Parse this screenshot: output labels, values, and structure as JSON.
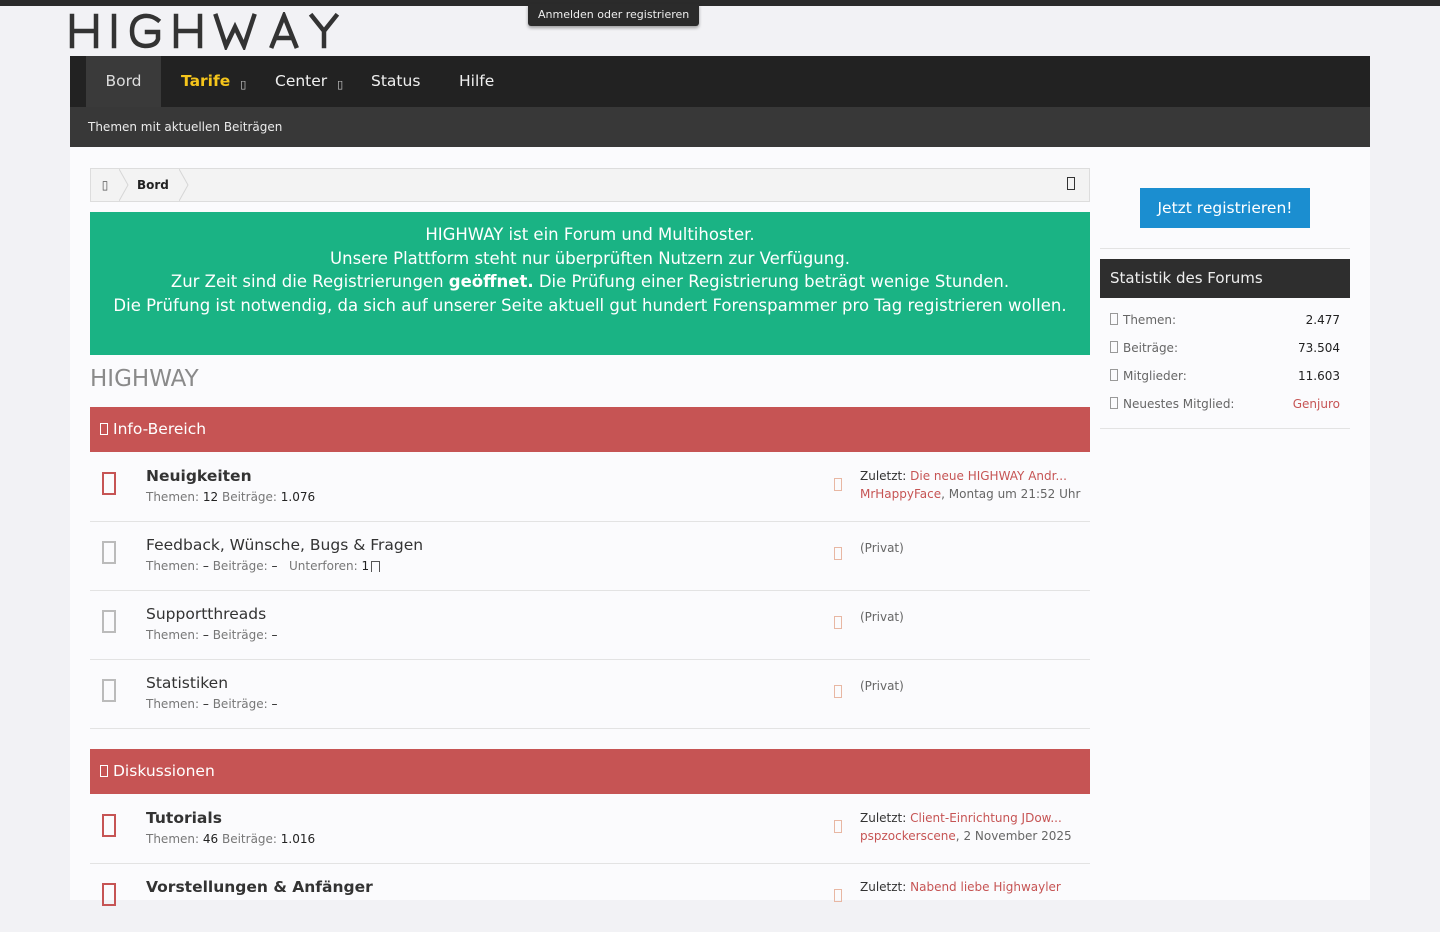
{
  "header": {
    "login_tab": "Anmelden oder registrieren",
    "logo_text": "HIGHWAY"
  },
  "nav": {
    "items": [
      {
        "label": "Bord"
      },
      {
        "label": "Tarife"
      },
      {
        "label": "Center"
      },
      {
        "label": "Status"
      },
      {
        "label": "Hilfe"
      }
    ],
    "sub_link": "Themen mit aktuellen Beiträgen"
  },
  "breadcrumb": {
    "current": "Bord"
  },
  "notice": {
    "line1": "HIGHWAY ist ein Forum und Multihoster.",
    "line2": "Unsere Plattform steht nur überprüften Nutzern zur Verfügung.",
    "line3_before": "Zur Zeit sind die Registrierungen ",
    "line3_bold": "geöffnet.",
    "line3_after": " Die Prüfung einer Registrierung beträgt wenige Stunden.",
    "line4": "Die Prüfung ist notwendig, da sich auf unserer Seite aktuell gut hundert Forenspammer pro Tag registrieren wollen.",
    "color": "#1ab384"
  },
  "forum": {
    "title": "HIGHWAY",
    "labels": {
      "themen": "Themen:",
      "beitraege": "Beiträge:",
      "unterforen": "Unterforen:",
      "zuletzt": "Zuletzt:",
      "privat": "(Privat)"
    },
    "categories": [
      {
        "name": "Info-Bereich",
        "forums": [
          {
            "name": "Neuigkeiten",
            "themen": "12",
            "beitraege": "1.076",
            "last_title": "Die neue HIGHWAY Andr...",
            "last_user": "MrHappyFace",
            "last_time": "Montag um 21:52 Uhr"
          },
          {
            "name": "Feedback, Wünsche, Bugs & Fragen",
            "themen": "–",
            "beitraege": "–",
            "unterforen": "1"
          },
          {
            "name": "Supportthreads",
            "themen": "–",
            "beitraege": "–"
          },
          {
            "name": "Statistiken",
            "themen": "–",
            "beitraege": "–"
          }
        ]
      },
      {
        "name": "Diskussionen",
        "forums": [
          {
            "name": "Tutorials",
            "themen": "46",
            "beitraege": "1.016",
            "last_title": "Client-Einrichtung JDow...",
            "last_user": "pspzockerscene",
            "last_time": "2 November 2025"
          },
          {
            "name": "Vorstellungen & Anfänger",
            "last_title": "Nabend liebe Highwayler"
          }
        ]
      }
    ]
  },
  "sidebar": {
    "register_button": "Jetzt registrieren!",
    "stats_title": "Statistik des Forums",
    "stats": [
      {
        "label": "Themen:",
        "value": "2.477"
      },
      {
        "label": "Beiträge:",
        "value": "73.504"
      },
      {
        "label": "Mitglieder:",
        "value": "11.603"
      },
      {
        "label": "Neuestes Mitglied:",
        "value": "Genjuro"
      }
    ]
  },
  "colors": {
    "accent_red": "#c65454",
    "register_blue": "#1b8ed0",
    "nav_gold": "#f5c51b",
    "nav_dark": "#222222"
  }
}
